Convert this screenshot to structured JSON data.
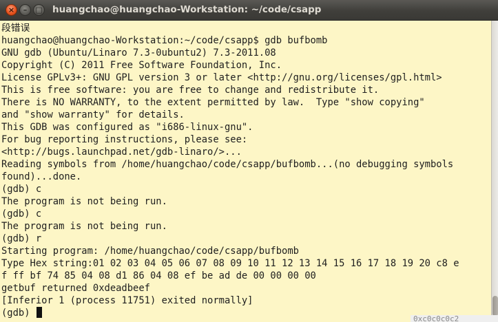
{
  "window": {
    "title": "huangchao@huangchao-Workstation: ~/code/csapp",
    "close_glyph": "×",
    "minimize_glyph": "–",
    "maximize_glyph": "□"
  },
  "terminal": {
    "lines": [
      "段错误",
      "huangchao@huangchao-Workstation:~/code/csapp$ gdb bufbomb",
      "GNU gdb (Ubuntu/Linaro 7.3-0ubuntu2) 7.3-2011.08",
      "Copyright (C) 2011 Free Software Foundation, Inc.",
      "License GPLv3+: GNU GPL version 3 or later <http://gnu.org/licenses/gpl.html>",
      "This is free software: you are free to change and redistribute it.",
      "There is NO WARRANTY, to the extent permitted by law.  Type \"show copying\"",
      "and \"show warranty\" for details.",
      "This GDB was configured as \"i686-linux-gnu\".",
      "For bug reporting instructions, please see:",
      "<http://bugs.launchpad.net/gdb-linaro/>...",
      "Reading symbols from /home/huangchao/code/csapp/bufbomb...(no debugging symbols",
      "found)...done.",
      "(gdb) c",
      "The program is not being run.",
      "(gdb) c",
      "The program is not being run.",
      "(gdb) r",
      "Starting program: /home/huangchao/code/csapp/bufbomb",
      "Type Hex string:01 02 03 04 05 06 07 08 09 10 11 12 13 14 15 16 17 18 19 20 c8 e",
      "f ff bf 74 85 04 08 d1 86 04 08 ef be ad de 00 00 00 00",
      "getbuf returned 0xdeadbeef",
      "[Inferior 1 (process 11751) exited normally]"
    ],
    "prompt": "(gdb) "
  },
  "background_window": {
    "text": "0xc0c0c0c2"
  }
}
